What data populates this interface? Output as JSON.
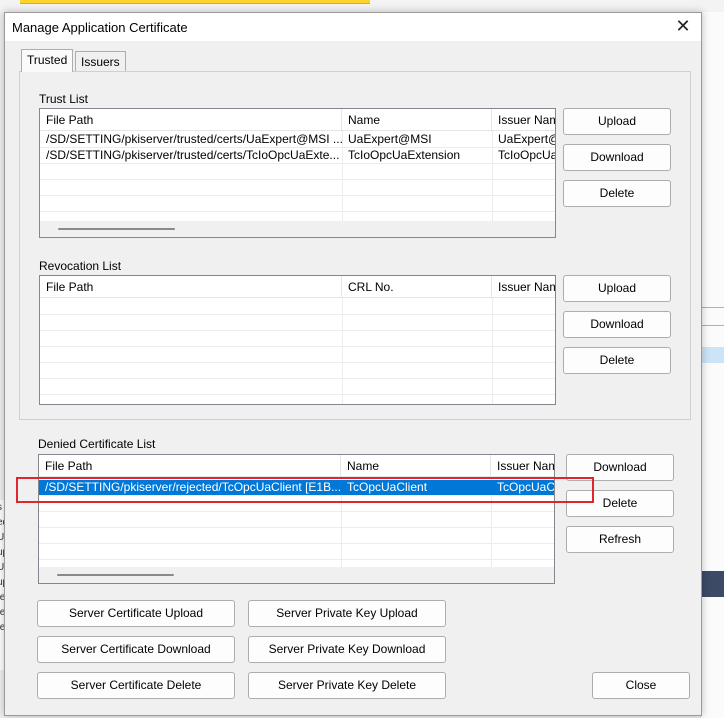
{
  "dialog": {
    "title": "Manage Application Certificate",
    "close_glyph": "✕"
  },
  "tabs": [
    {
      "label": "Trusted",
      "active": true
    },
    {
      "label": "Issuers",
      "active": false
    }
  ],
  "trust_list": {
    "label": "Trust List",
    "columns": [
      "File Path",
      "Name",
      "Issuer Nam"
    ],
    "rows": [
      {
        "file_path": "/SD/SETTING/pkiserver/trusted/certs/UaExpert@MSI ...",
        "name": "UaExpert@MSI",
        "issuer": "UaExpert@I"
      },
      {
        "file_path": "/SD/SETTING/pkiserver/trusted/certs/TcIoOpcUaExte...",
        "name": "TcIoOpcUaExtension",
        "issuer": "TcIoOpcUa"
      }
    ],
    "buttons": {
      "upload": "Upload",
      "download": "Download",
      "delete": "Delete"
    }
  },
  "revocation_list": {
    "label": "Revocation List",
    "columns": [
      "File Path",
      "CRL No.",
      "Issuer Nam"
    ],
    "rows": [],
    "buttons": {
      "upload": "Upload",
      "download": "Download",
      "delete": "Delete"
    }
  },
  "denied_list": {
    "label": "Denied Certificate List",
    "columns": [
      "File Path",
      "Name",
      "Issuer Nam"
    ],
    "rows": [
      {
        "file_path": "/SD/SETTING/pkiserver/rejected/TcOpcUaClient [E1B...",
        "name": "TcOpcUaClient",
        "issuer": "TcOpcUaCl",
        "selected": true
      }
    ],
    "buttons": {
      "download": "Download",
      "delete": "Delete",
      "refresh": "Refresh"
    }
  },
  "bottom_buttons": {
    "server_cert_upload": "Server Certificate Upload",
    "server_cert_download": "Server Certificate Download",
    "server_cert_delete": "Server Certificate Delete",
    "server_key_upload": "Server Private Key Upload",
    "server_key_download": "Server Private Key Download",
    "server_key_delete": "Server Private Key Delete",
    "close": "Close"
  },
  "background": {
    "left_fragments": [
      "s",
      "ed",
      "Ua",
      "up",
      "Ua",
      "up",
      "te",
      "te",
      "te"
    ]
  },
  "colors": {
    "selection": "#0078d7",
    "highlight_box": "#e0262a"
  }
}
